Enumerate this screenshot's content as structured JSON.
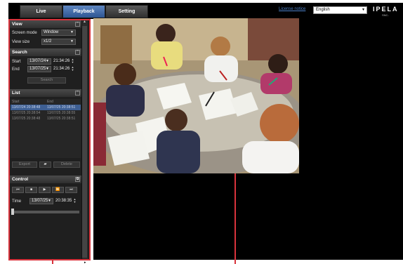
{
  "tabs": [
    {
      "label": "Live"
    },
    {
      "label": "Playback"
    },
    {
      "label": "Setting"
    }
  ],
  "header": {
    "license_link": "License notice",
    "language": "English",
    "logo": "IPELA",
    "model": "SNC-"
  },
  "view": {
    "title": "View",
    "screen_mode_label": "Screen mode",
    "screen_mode_value": "Window",
    "view_size_label": "View size",
    "view_size_value": "x1/2"
  },
  "search": {
    "title": "Search",
    "start_label": "Start",
    "start_date": "13/07/24",
    "start_time": "21:34:26",
    "end_label": "End",
    "end_date": "13/07/25",
    "end_time": "21:34:26",
    "search_button": "Search"
  },
  "list": {
    "title": "List",
    "col_start": "Start",
    "col_end": "End",
    "rows": [
      {
        "start": "13/07/24 20:38:48",
        "end": "13/07/25 20:38:51",
        "selected": true
      },
      {
        "start": "13/07/25 20:38:54",
        "end": "13/07/25 20:38:55",
        "selected": false
      },
      {
        "start": "13/07/25 20:38:48",
        "end": "13/07/25 20:38:51",
        "selected": false
      }
    ],
    "export_button": "Export",
    "delete_button": "Delete"
  },
  "control": {
    "title": "Control",
    "time_label": "Time",
    "time_date": "13/07/25",
    "time_value": "20:38:35",
    "playback_position": 0.0
  },
  "icons": {
    "collapse": "collapse-icon",
    "folder": "folder-icon",
    "prev": "skip-previous-icon",
    "stop": "stop-icon",
    "play": "play-icon",
    "ff": "fast-forward-icon",
    "next": "skip-next-icon",
    "popout": "popout-icon"
  },
  "colors": {
    "active_tab": "#3f6aaa",
    "highlight_border": "#d8333c",
    "selected_row": "#3e5f93"
  }
}
